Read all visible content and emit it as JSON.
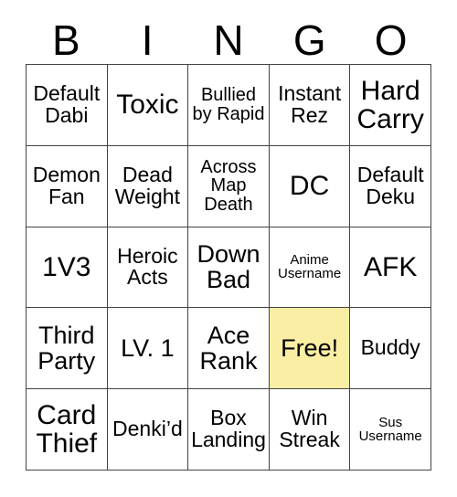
{
  "card": {
    "title_letters": [
      "B",
      "I",
      "N",
      "G",
      "O"
    ],
    "free_space_color": "#faeea5",
    "border_color": "#444444",
    "background_color": "#ffffff",
    "rows": [
      [
        {
          "label": "Default Dabi",
          "size": "md",
          "free": false
        },
        {
          "label": "Toxic",
          "size": "xl",
          "free": false
        },
        {
          "label": "Bullied by Rapid",
          "size": "sm",
          "free": false
        },
        {
          "label": "Instant Rez",
          "size": "md",
          "free": false
        },
        {
          "label": "Hard Carry",
          "size": "xl",
          "free": false
        }
      ],
      [
        {
          "label": "Demon Fan",
          "size": "md",
          "free": false
        },
        {
          "label": "Dead Weight",
          "size": "md",
          "free": false
        },
        {
          "label": "Across Map Death",
          "size": "sm",
          "free": false
        },
        {
          "label": "DC",
          "size": "xl",
          "free": false
        },
        {
          "label": "Default Deku",
          "size": "md",
          "free": false
        }
      ],
      [
        {
          "label": "1V3",
          "size": "xl",
          "free": false
        },
        {
          "label": "Heroic Acts",
          "size": "md",
          "free": false
        },
        {
          "label": "Down Bad",
          "size": "lg",
          "free": false
        },
        {
          "label": "Anime Username",
          "size": "xs",
          "free": false
        },
        {
          "label": "AFK",
          "size": "xl",
          "free": false
        }
      ],
      [
        {
          "label": "Third Party",
          "size": "lg",
          "free": false
        },
        {
          "label": "LV. 1",
          "size": "lg",
          "free": false
        },
        {
          "label": "Ace Rank",
          "size": "lg",
          "free": false
        },
        {
          "label": "Free!",
          "size": "lg",
          "free": true
        },
        {
          "label": "Buddy",
          "size": "md",
          "free": false
        }
      ],
      [
        {
          "label": "Card Thief",
          "size": "xl",
          "free": false
        },
        {
          "label": "Denki’d",
          "size": "md",
          "free": false
        },
        {
          "label": "Box Landing",
          "size": "md",
          "free": false
        },
        {
          "label": "Win Streak",
          "size": "md",
          "free": false
        },
        {
          "label": "Sus Username",
          "size": "xs",
          "free": false
        }
      ]
    ]
  }
}
